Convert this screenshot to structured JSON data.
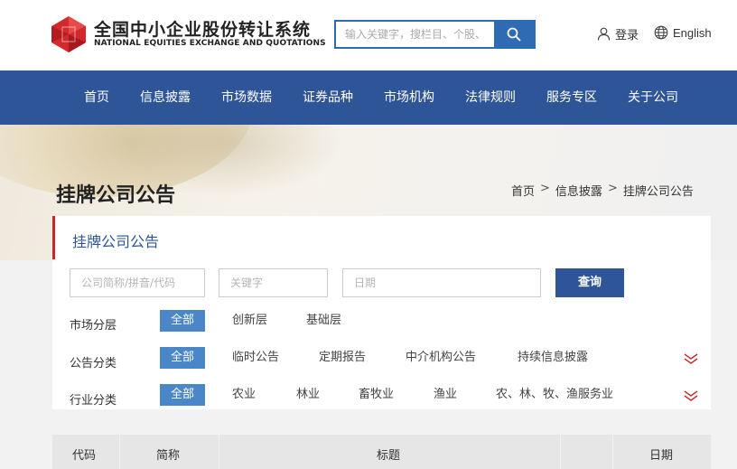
{
  "brand": {
    "name_cn": "全国中小企业股份转让系统",
    "name_en": "NATIONAL EQUITIES EXCHANGE AND QUOTATIONS"
  },
  "search": {
    "placeholder": "输入关键字，搜栏目、个股、"
  },
  "header": {
    "login_label": "登录",
    "language_label": "English"
  },
  "nav": {
    "items": [
      {
        "label": "首页"
      },
      {
        "label": "信息披露"
      },
      {
        "label": "市场数据"
      },
      {
        "label": "证券品种"
      },
      {
        "label": "市场机构"
      },
      {
        "label": "法律规则"
      },
      {
        "label": "服务专区"
      },
      {
        "label": "关于公司"
      }
    ]
  },
  "page": {
    "title": "挂牌公司公告"
  },
  "breadcrumb": {
    "items": [
      {
        "label": "首页"
      },
      {
        "label": "信息披露"
      },
      {
        "label": "挂牌公司公告"
      }
    ],
    "separator": ">"
  },
  "panel": {
    "title": "挂牌公司公告",
    "company_placeholder": "公司简称/拼音/代码",
    "keyword_placeholder": "关键字",
    "date_placeholder": "日期",
    "query_label": "查询"
  },
  "filters": {
    "market": {
      "label": "市场分层",
      "options": [
        "全部",
        "创新层",
        "基础层"
      ],
      "selected": "全部"
    },
    "announcement": {
      "label": "公告分类",
      "options": [
        "全部",
        "临时公告",
        "定期报告",
        "中介机构公告",
        "持续信息披露"
      ],
      "selected": "全部"
    },
    "industry": {
      "label": "行业分类",
      "options": [
        "全部",
        "农业",
        "林业",
        "畜牧业",
        "渔业",
        "农、林、牧、渔服务业"
      ],
      "selected": "全部"
    }
  },
  "table": {
    "columns": [
      "代码",
      "简称",
      "标题",
      "日期"
    ]
  },
  "colors": {
    "nav_bg": "#2e5597",
    "accent_red": "#c7282a",
    "chip_active": "#4a86c8",
    "search_blue": "#2f6bb3"
  }
}
